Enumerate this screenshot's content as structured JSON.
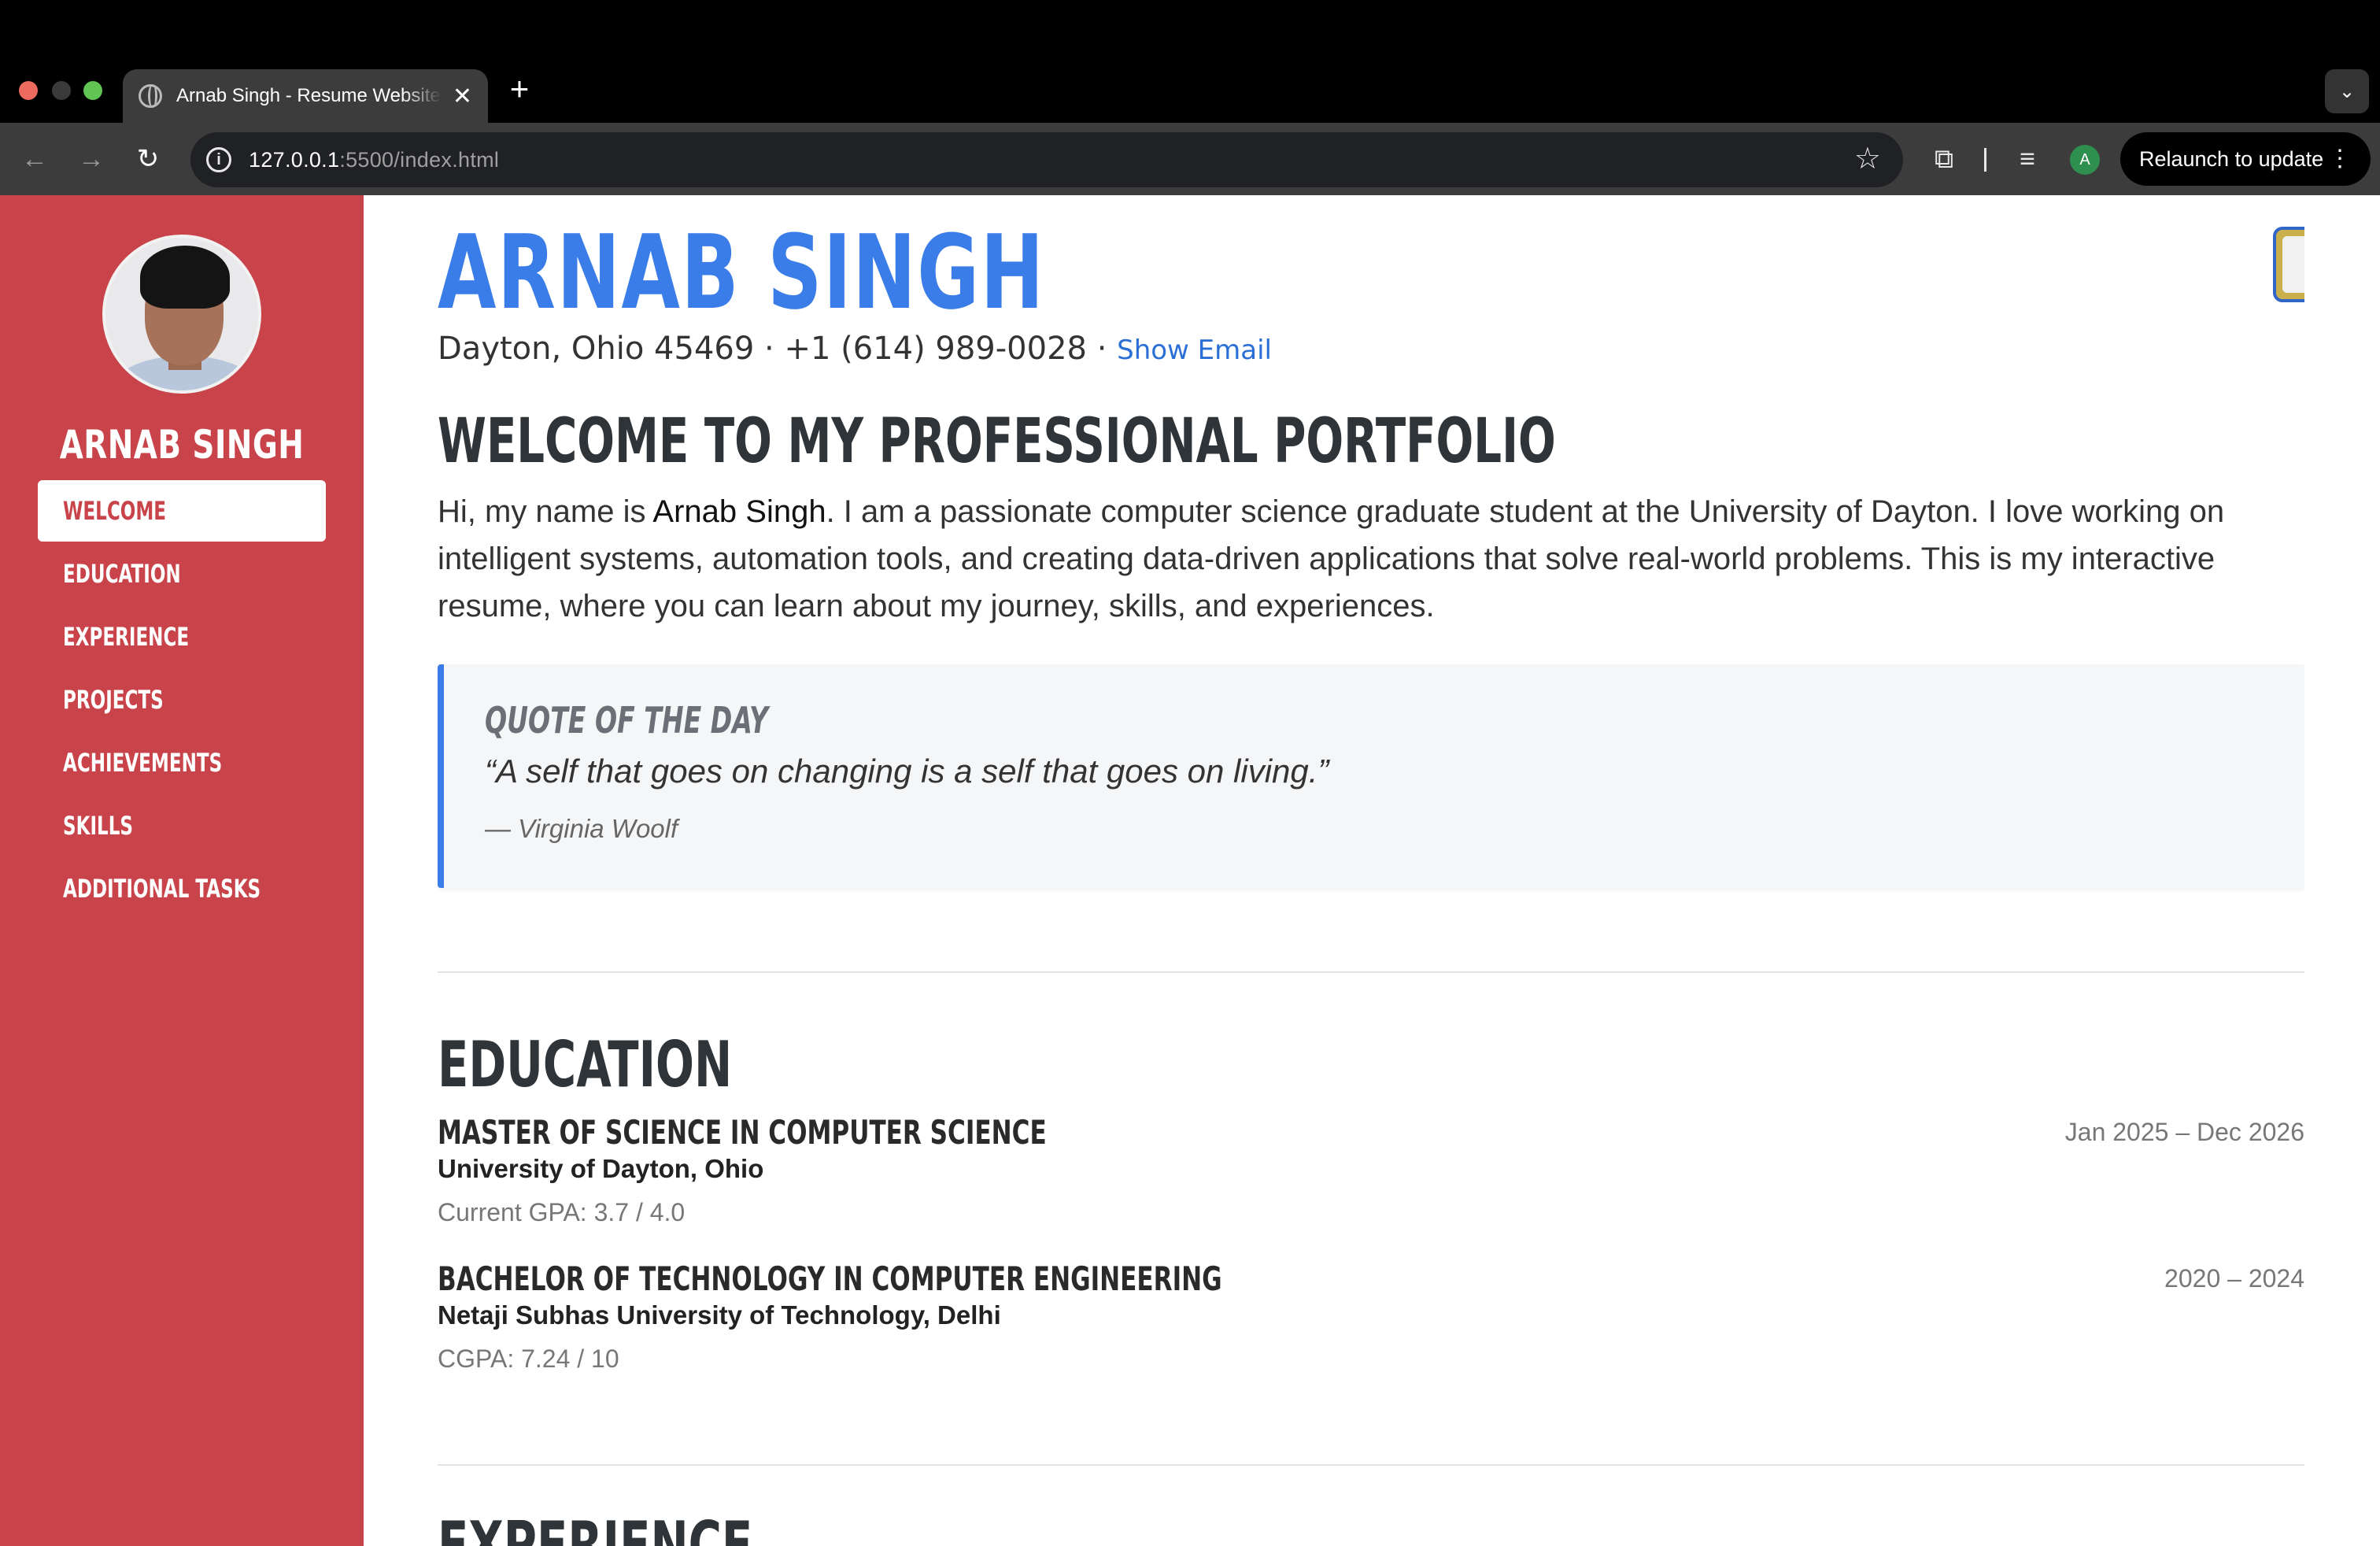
{
  "browser": {
    "tab_title": "Arnab Singh - Resume Website",
    "new_tab_symbol": "+",
    "close_symbol": "✕",
    "url_host": "127.0.0.1",
    "url_path": ":5500/index.html",
    "profile_initial": "A",
    "relaunch_label": "Relaunch to update"
  },
  "sidebar": {
    "name": "ARNAB SINGH",
    "items": [
      {
        "label": "WELCOME",
        "active": true
      },
      {
        "label": "EDUCATION"
      },
      {
        "label": "EXPERIENCE"
      },
      {
        "label": "PROJECTS"
      },
      {
        "label": "ACHIEVEMENTS"
      },
      {
        "label": "SKILLS"
      },
      {
        "label": "ADDITIONAL TASKS"
      }
    ]
  },
  "header": {
    "name": "ARNAB SINGH",
    "address": "Dayton, Ohio 45469 · +1 (614) 989-0028 · ",
    "show_email": "Show Email",
    "theme_toggle_icon": "moon-icon"
  },
  "welcome": {
    "heading": "WELCOME TO MY PROFESSIONAL PORTFOLIO",
    "intro_before": "Hi, my name is ",
    "intro_name": "Arnab Singh",
    "intro_after": ". I am a passionate computer science graduate student at the University of Dayton. I love working on intelligent systems, automation tools, and creating data-driven applications that solve real-world problems. This is my interactive resume, where you can learn about my journey, skills, and experiences."
  },
  "quote": {
    "heading": "QUOTE OF THE DAY",
    "text": "“A self that goes on changing is a self that goes on living.”",
    "author": "— Virginia Woolf"
  },
  "education": {
    "heading": "EDUCATION",
    "items": [
      {
        "degree": "MASTER OF SCIENCE IN COMPUTER SCIENCE",
        "school": "University of Dayton, Ohio",
        "gpa": "Current GPA: 3.7 / 4.0",
        "date": "Jan 2025 – Dec 2026"
      },
      {
        "degree": "BACHELOR OF TECHNOLOGY IN COMPUTER ENGINEERING",
        "school": "Netaji Subhas University of Technology, Delhi",
        "gpa": "CGPA: 7.24 / 10",
        "date": "2020 – 2024"
      }
    ]
  },
  "experience": {
    "heading": "EXPERIENCE"
  },
  "colors": {
    "sidebar_bg": "#c9444a",
    "accent_blue": "#3b7de8",
    "link_blue": "#2a6fd6"
  }
}
